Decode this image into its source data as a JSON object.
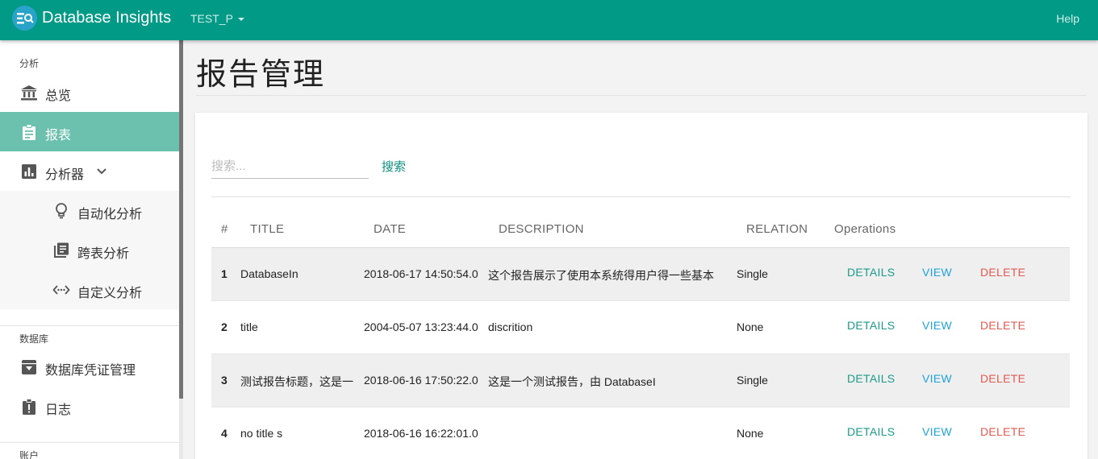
{
  "app": {
    "title": "Database Insights",
    "database_selector": "TEST_P",
    "help_label": "Help"
  },
  "sidebar": {
    "section_analysis": "分析",
    "items": [
      {
        "label": "总览",
        "icon": "bank-icon"
      },
      {
        "label": "报表",
        "icon": "clipboard-icon",
        "active": true
      },
      {
        "label": "分析器",
        "icon": "bar-chart-icon",
        "expanded": true
      }
    ],
    "sub_items": [
      {
        "label": "自动化分析",
        "icon": "lightbulb-icon"
      },
      {
        "label": "跨表分析",
        "icon": "library-books-icon"
      },
      {
        "label": "自定义分析",
        "icon": "settings-ethernet-icon"
      }
    ],
    "section_database": "数据库",
    "db_items": [
      {
        "label": "数据库凭证管理",
        "icon": "archive-icon"
      },
      {
        "label": "日志",
        "icon": "report-icon"
      }
    ],
    "section_account": "账户"
  },
  "main": {
    "page_title": "报告管理",
    "search": {
      "placeholder": "搜索...",
      "button_label": "搜索"
    },
    "table": {
      "headers": [
        "#",
        "TITLE",
        "DATE",
        "DESCRIPTION",
        "RELATION",
        "Operations"
      ],
      "rows": [
        {
          "index": "1",
          "title": "DatabaseIn",
          "date": "2018-06-17 14:50:54.0",
          "description": "这个报告展示了使用本系统得用户得一些基本",
          "relation": "Single"
        },
        {
          "index": "2",
          "title": "title",
          "date": "2004-05-07 13:23:44.0",
          "description": "discrition",
          "relation": "None"
        },
        {
          "index": "3",
          "title": "测试报告标题，这是一",
          "date": "2018-06-16 17:50:22.0",
          "description": "这是一个测试报告，由 DatabaseI",
          "relation": "Single"
        },
        {
          "index": "4",
          "title": "no title s",
          "date": "2018-06-16 16:22:01.0",
          "description": "",
          "relation": "None"
        }
      ],
      "actions": {
        "details": "DETAILS",
        "view": "VIEW",
        "delete": "DELETE"
      }
    }
  },
  "colors": {
    "header": "#009a86",
    "active_nav": "#6cc0ae",
    "details": "#1a9b8a",
    "view": "#1fa3dc",
    "delete": "#e05a52"
  }
}
